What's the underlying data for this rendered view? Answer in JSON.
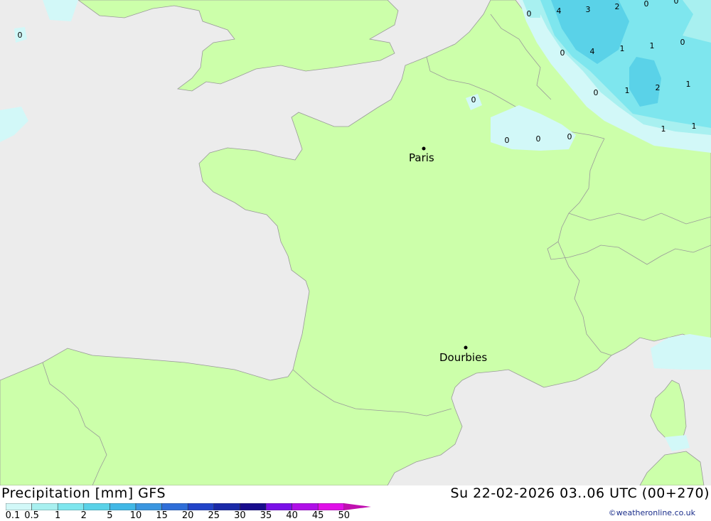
{
  "map": {
    "cities": [
      {
        "name": "Paris"
      },
      {
        "name": "Dourbies"
      }
    ],
    "precip_labels": [
      "0",
      "4",
      "3",
      "2",
      "0",
      "0",
      "0",
      "4",
      "1",
      "1",
      "0",
      "0",
      "1",
      "2",
      "1",
      "0",
      "0",
      "0",
      "0",
      "1",
      "1",
      "0"
    ]
  },
  "footer": {
    "title": "Precipitation [mm] GFS",
    "date": "Su 22-02-2026 03..06 UTC (00+270)",
    "credit": "©weatheronline.co.uk",
    "scale": [
      {
        "label": "0.1",
        "color": "#d2f8f8"
      },
      {
        "label": "0.5",
        "color": "#a8f0f0"
      },
      {
        "label": "1",
        "color": "#7ee6ee"
      },
      {
        "label": "2",
        "color": "#5ad2e8"
      },
      {
        "label": "5",
        "color": "#41b8e6"
      },
      {
        "label": "10",
        "color": "#3a96e0"
      },
      {
        "label": "15",
        "color": "#2f6ed8"
      },
      {
        "label": "20",
        "color": "#2244c8"
      },
      {
        "label": "25",
        "color": "#1a2aa8"
      },
      {
        "label": "30",
        "color": "#180c8c"
      },
      {
        "label": "35",
        "color": "#7a10e8"
      },
      {
        "label": "40",
        "color": "#b010e8"
      },
      {
        "label": "45",
        "color": "#e010e8"
      },
      {
        "label": "50",
        "color": "#c010b0"
      }
    ]
  },
  "colors": {
    "sea": "#ececec",
    "land": "#ccffaa",
    "border": "#999999"
  }
}
